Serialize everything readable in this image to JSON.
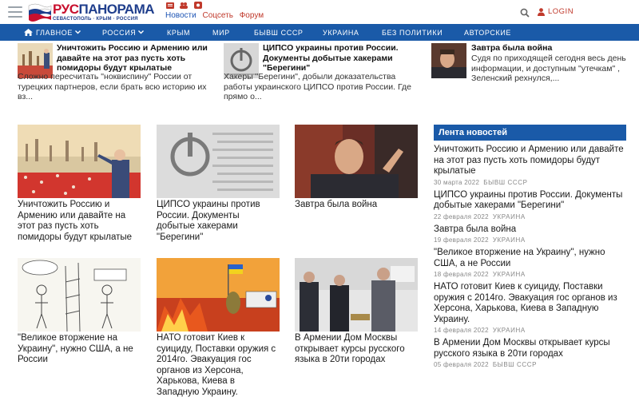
{
  "header": {
    "logo_main": "РУС",
    "logo_brand": "ПАНОРАМА",
    "logo_sub": "СЕВАСТОПОЛЬ · КРЫМ · РОССИЯ",
    "site_links": [
      "Новости",
      "Соцсеть",
      "Форум"
    ],
    "login_label": "LOGIN"
  },
  "nav": {
    "items": [
      "ГЛАВНОЕ",
      "РОССИЯ",
      "КРЫМ",
      "МИР",
      "БЫВШ СССР",
      "УКРАИНА",
      "БЕЗ ПОЛИТИКИ",
      "АВТОРСКИЕ"
    ]
  },
  "top_news": [
    {
      "title": "Уничтожить Россию и Армению или давайте на этот раз пусть хоть помидоры будут крылатые",
      "excerpt": "Сложно пересчитать \"ноквиспину\" России от турецких партнеров, если брать всю историю их вз..."
    },
    {
      "title": "ЦИПСО украины против России. Документы добытые хакерами \"Берегини\"",
      "excerpt": "Хакеры \"Берегини\", добыли доказательства работы украинского ЦИПСО против России. Где прямо о..."
    },
    {
      "title": "Завтра была война",
      "excerpt": "Судя по приходящей сегодня весь день информации, и доступным \"утечкам\" , Зеленский рехнулся,..."
    }
  ],
  "grid": [
    {
      "title": "Уничтожить Россию и Армению или давайте на этот раз пусть хоть помидоры будут крылатые"
    },
    {
      "title": "ЦИПСО украины против России. Документы добытые хакерами \"Берегини\""
    },
    {
      "title": "Завтра была война"
    },
    {
      "title": "\"Великое вторжение на Украину\", нужно США, а не России"
    },
    {
      "title": "НАТО готовит Киев к суициду, Поставки оружия с 2014го. Эвакуация гос органов из Херсона, Харькова, Киева в Западную Украину."
    },
    {
      "title": "В Армении Дом Москвы открывает курсы русского языка в 20ти городах"
    }
  ],
  "sidebar": {
    "heading": "Лента новостей",
    "items": [
      {
        "title": "Уничтожить Россию и Армению или давайте на этот раз пусть хоть помидоры будут крылатые",
        "date": "30 марта 2022",
        "category": "БЫВШ СССР"
      },
      {
        "title": "ЦИПСО украины против России. Документы добытые хакерами \"Берегини\"",
        "date": "22 февраля 2022",
        "category": "УКРАИНА"
      },
      {
        "title": "Завтра была война",
        "date": "19 февраля 2022",
        "category": "УКРАИНА"
      },
      {
        "title": "\"Великое вторжение на Украину\", нужно США, а не России",
        "date": "18 февраля 2022",
        "category": "УКРАИНА"
      },
      {
        "title": "НАТО готовит Киев к суициду, Поставки оружия с 2014го. Эвакуация гос органов из Херсона, Харькова, Киева в Западную Украину.",
        "date": "14 февраля 2022",
        "category": "УКРАИНА"
      },
      {
        "title": "В Армении Дом Москвы открывает курсы русского языка в 20ти городах",
        "date": "05 февраля 2022",
        "category": "БЫВШ СССР"
      }
    ]
  },
  "colors": {
    "nav_bg": "#1a5aa8",
    "brand_red": "#c8102e",
    "brand_blue": "#1f3e8c",
    "link_red": "#c0392b"
  }
}
